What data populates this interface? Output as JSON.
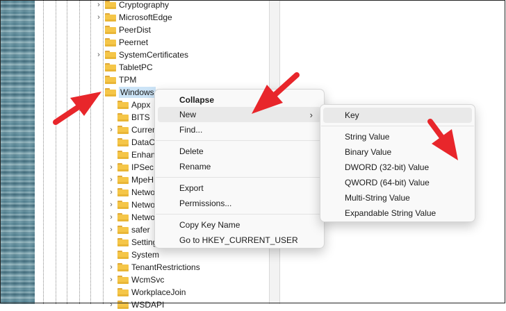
{
  "tree": {
    "items": [
      {
        "label": "Cryptography",
        "expand": "›",
        "level": 0
      },
      {
        "label": "MicrosoftEdge",
        "expand": "›",
        "level": 0
      },
      {
        "label": "PeerDist",
        "expand": "",
        "level": 0
      },
      {
        "label": "Peernet",
        "expand": "",
        "level": 0
      },
      {
        "label": "SystemCertificates",
        "expand": "›",
        "level": 0
      },
      {
        "label": "TabletPC",
        "expand": "",
        "level": 0
      },
      {
        "label": "TPM",
        "expand": "",
        "level": 0
      },
      {
        "label": "Windows",
        "expand": "⌄",
        "level": 0,
        "selected": true
      },
      {
        "label": "Appx",
        "expand": "",
        "level": 1
      },
      {
        "label": "BITS",
        "expand": "",
        "level": 1
      },
      {
        "label": "Curren",
        "expand": "›",
        "level": 1
      },
      {
        "label": "DataCo",
        "expand": "",
        "level": 1
      },
      {
        "label": "Enhan",
        "expand": "",
        "level": 1
      },
      {
        "label": "IPSec",
        "expand": "›",
        "level": 1
      },
      {
        "label": "MpeH",
        "expand": "›",
        "level": 1
      },
      {
        "label": "Netwo",
        "expand": "›",
        "level": 1
      },
      {
        "label": "Netwo",
        "expand": "›",
        "level": 1
      },
      {
        "label": "Netwo",
        "expand": "›",
        "level": 1
      },
      {
        "label": "safer",
        "expand": "›",
        "level": 1
      },
      {
        "label": "Setting",
        "expand": "",
        "level": 1
      },
      {
        "label": "System",
        "expand": "",
        "level": 1
      },
      {
        "label": "TenantRestrictions",
        "expand": "›",
        "level": 1
      },
      {
        "label": "WcmSvc",
        "expand": "›",
        "level": 1
      },
      {
        "label": "WorkplaceJoin",
        "expand": "",
        "level": 1
      },
      {
        "label": "WSDAPI",
        "expand": "›",
        "level": 1
      }
    ]
  },
  "context_menu": {
    "collapse": "Collapse",
    "new": "New",
    "new_arrow": "›",
    "find": "Find...",
    "delete": "Delete",
    "rename": "Rename",
    "export": "Export",
    "permissions": "Permissions...",
    "copy_key_name": "Copy Key Name",
    "goto": "Go to HKEY_CURRENT_USER"
  },
  "submenu": {
    "key": "Key",
    "string_value": "String Value",
    "binary_value": "Binary Value",
    "dword_value": "DWORD (32-bit) Value",
    "qword_value": "QWORD (64-bit) Value",
    "multi_string_value": "Multi-String Value",
    "expandable_string_value": "Expandable String Value"
  },
  "colors": {
    "annotation_arrow": "#e8262b",
    "folder": "#f5c648",
    "selection": "#cce4f7"
  }
}
